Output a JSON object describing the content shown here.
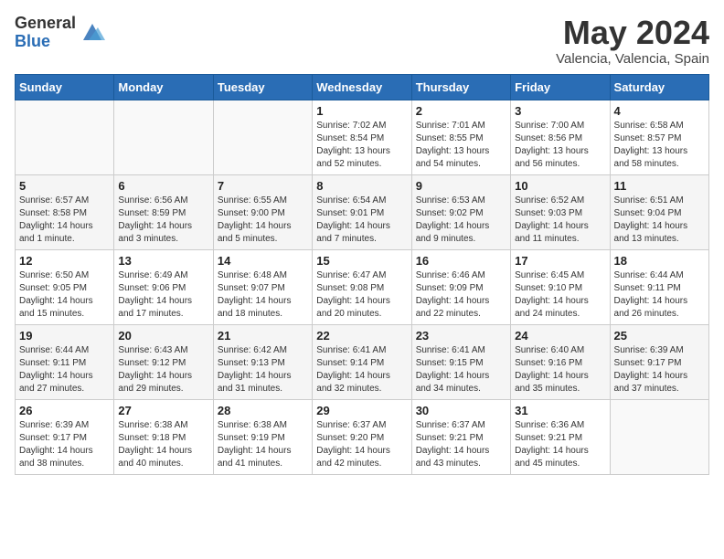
{
  "header": {
    "logo_general": "General",
    "logo_blue": "Blue",
    "month_title": "May 2024",
    "location": "Valencia, Valencia, Spain"
  },
  "weekdays": [
    "Sunday",
    "Monday",
    "Tuesday",
    "Wednesday",
    "Thursday",
    "Friday",
    "Saturday"
  ],
  "weeks": [
    [
      {
        "day": "",
        "info": ""
      },
      {
        "day": "",
        "info": ""
      },
      {
        "day": "",
        "info": ""
      },
      {
        "day": "1",
        "info": "Sunrise: 7:02 AM\nSunset: 8:54 PM\nDaylight: 13 hours and 52 minutes."
      },
      {
        "day": "2",
        "info": "Sunrise: 7:01 AM\nSunset: 8:55 PM\nDaylight: 13 hours and 54 minutes."
      },
      {
        "day": "3",
        "info": "Sunrise: 7:00 AM\nSunset: 8:56 PM\nDaylight: 13 hours and 56 minutes."
      },
      {
        "day": "4",
        "info": "Sunrise: 6:58 AM\nSunset: 8:57 PM\nDaylight: 13 hours and 58 minutes."
      }
    ],
    [
      {
        "day": "5",
        "info": "Sunrise: 6:57 AM\nSunset: 8:58 PM\nDaylight: 14 hours and 1 minute."
      },
      {
        "day": "6",
        "info": "Sunrise: 6:56 AM\nSunset: 8:59 PM\nDaylight: 14 hours and 3 minutes."
      },
      {
        "day": "7",
        "info": "Sunrise: 6:55 AM\nSunset: 9:00 PM\nDaylight: 14 hours and 5 minutes."
      },
      {
        "day": "8",
        "info": "Sunrise: 6:54 AM\nSunset: 9:01 PM\nDaylight: 14 hours and 7 minutes."
      },
      {
        "day": "9",
        "info": "Sunrise: 6:53 AM\nSunset: 9:02 PM\nDaylight: 14 hours and 9 minutes."
      },
      {
        "day": "10",
        "info": "Sunrise: 6:52 AM\nSunset: 9:03 PM\nDaylight: 14 hours and 11 minutes."
      },
      {
        "day": "11",
        "info": "Sunrise: 6:51 AM\nSunset: 9:04 PM\nDaylight: 14 hours and 13 minutes."
      }
    ],
    [
      {
        "day": "12",
        "info": "Sunrise: 6:50 AM\nSunset: 9:05 PM\nDaylight: 14 hours and 15 minutes."
      },
      {
        "day": "13",
        "info": "Sunrise: 6:49 AM\nSunset: 9:06 PM\nDaylight: 14 hours and 17 minutes."
      },
      {
        "day": "14",
        "info": "Sunrise: 6:48 AM\nSunset: 9:07 PM\nDaylight: 14 hours and 18 minutes."
      },
      {
        "day": "15",
        "info": "Sunrise: 6:47 AM\nSunset: 9:08 PM\nDaylight: 14 hours and 20 minutes."
      },
      {
        "day": "16",
        "info": "Sunrise: 6:46 AM\nSunset: 9:09 PM\nDaylight: 14 hours and 22 minutes."
      },
      {
        "day": "17",
        "info": "Sunrise: 6:45 AM\nSunset: 9:10 PM\nDaylight: 14 hours and 24 minutes."
      },
      {
        "day": "18",
        "info": "Sunrise: 6:44 AM\nSunset: 9:11 PM\nDaylight: 14 hours and 26 minutes."
      }
    ],
    [
      {
        "day": "19",
        "info": "Sunrise: 6:44 AM\nSunset: 9:11 PM\nDaylight: 14 hours and 27 minutes."
      },
      {
        "day": "20",
        "info": "Sunrise: 6:43 AM\nSunset: 9:12 PM\nDaylight: 14 hours and 29 minutes."
      },
      {
        "day": "21",
        "info": "Sunrise: 6:42 AM\nSunset: 9:13 PM\nDaylight: 14 hours and 31 minutes."
      },
      {
        "day": "22",
        "info": "Sunrise: 6:41 AM\nSunset: 9:14 PM\nDaylight: 14 hours and 32 minutes."
      },
      {
        "day": "23",
        "info": "Sunrise: 6:41 AM\nSunset: 9:15 PM\nDaylight: 14 hours and 34 minutes."
      },
      {
        "day": "24",
        "info": "Sunrise: 6:40 AM\nSunset: 9:16 PM\nDaylight: 14 hours and 35 minutes."
      },
      {
        "day": "25",
        "info": "Sunrise: 6:39 AM\nSunset: 9:17 PM\nDaylight: 14 hours and 37 minutes."
      }
    ],
    [
      {
        "day": "26",
        "info": "Sunrise: 6:39 AM\nSunset: 9:17 PM\nDaylight: 14 hours and 38 minutes."
      },
      {
        "day": "27",
        "info": "Sunrise: 6:38 AM\nSunset: 9:18 PM\nDaylight: 14 hours and 40 minutes."
      },
      {
        "day": "28",
        "info": "Sunrise: 6:38 AM\nSunset: 9:19 PM\nDaylight: 14 hours and 41 minutes."
      },
      {
        "day": "29",
        "info": "Sunrise: 6:37 AM\nSunset: 9:20 PM\nDaylight: 14 hours and 42 minutes."
      },
      {
        "day": "30",
        "info": "Sunrise: 6:37 AM\nSunset: 9:21 PM\nDaylight: 14 hours and 43 minutes."
      },
      {
        "day": "31",
        "info": "Sunrise: 6:36 AM\nSunset: 9:21 PM\nDaylight: 14 hours and 45 minutes."
      },
      {
        "day": "",
        "info": ""
      }
    ]
  ]
}
